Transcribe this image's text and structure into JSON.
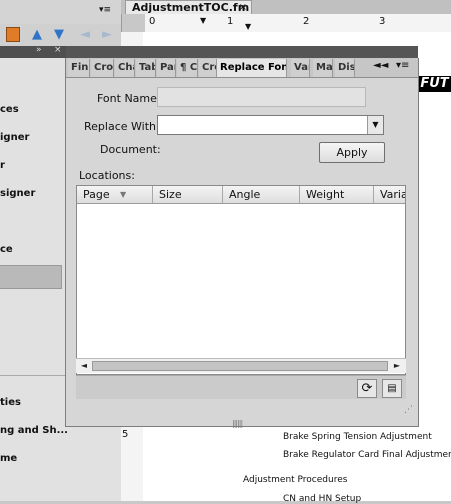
{
  "document": {
    "tab_title": "AdjustmentTOC.fm",
    "tab_close": "×",
    "ruler_numbers": [
      "0",
      "1",
      "2",
      "3"
    ],
    "vertical_ruler_number": "5",
    "lines": [
      "Brake Spring Tension Adjustment",
      "Brake Regulator Card Final Adjustment",
      "Adjustment Procedures",
      "CN and HN Setup"
    ],
    "logo_text": "FUT"
  },
  "left_panel": {
    "items": [
      "ces",
      "igner",
      "r",
      "signer",
      "ce",
      "ties",
      "ng and Sh...",
      "me"
    ]
  },
  "floating_panel": {
    "tabs": [
      "Fin",
      "Cro",
      "Cha",
      "Tab",
      "Par",
      "¶ C",
      "Cro",
      "Replace Font",
      "Var",
      "Ma",
      "Dis"
    ],
    "labels": {
      "font_name": "Font Name:",
      "replace_with": "Replace With:",
      "document": "Document:",
      "locations": "Locations:"
    },
    "inputs": {
      "font_name_value": "",
      "replace_with_value": ""
    },
    "apply_label": "Apply",
    "table_headers": [
      "Page",
      "Size",
      "Angle",
      "Weight",
      "Variat"
    ]
  },
  "icons": {
    "arrow_up": "▲",
    "arrow_down": "▼",
    "arrow_left": "◄",
    "arrow_right": "►",
    "refresh": "⟳",
    "menu": "≡"
  }
}
